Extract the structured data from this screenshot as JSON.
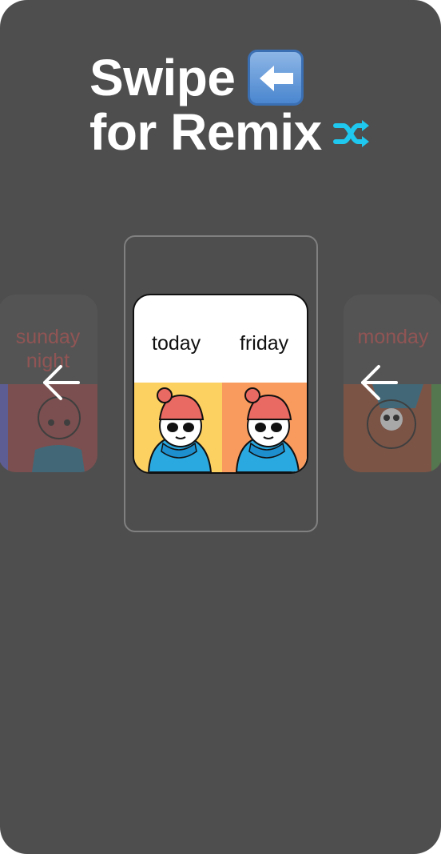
{
  "headline": {
    "line1": "Swipe",
    "line2": "for Remix"
  },
  "icons": {
    "left_emoji": "left-arrow-emoji-icon",
    "shuffle": "shuffle-icon",
    "swipe": "left-arrow-icon"
  },
  "colors": {
    "background": "#4e4e4e",
    "shuffle": "#1ec8ee",
    "panel_left": "#fdd062",
    "panel_right": "#f99a5e"
  },
  "carousel": {
    "prev_card": {
      "text": "sunday night"
    },
    "current_card": {
      "label_left": "today",
      "label_right": "friday"
    },
    "next_card": {
      "text": "monday"
    }
  }
}
